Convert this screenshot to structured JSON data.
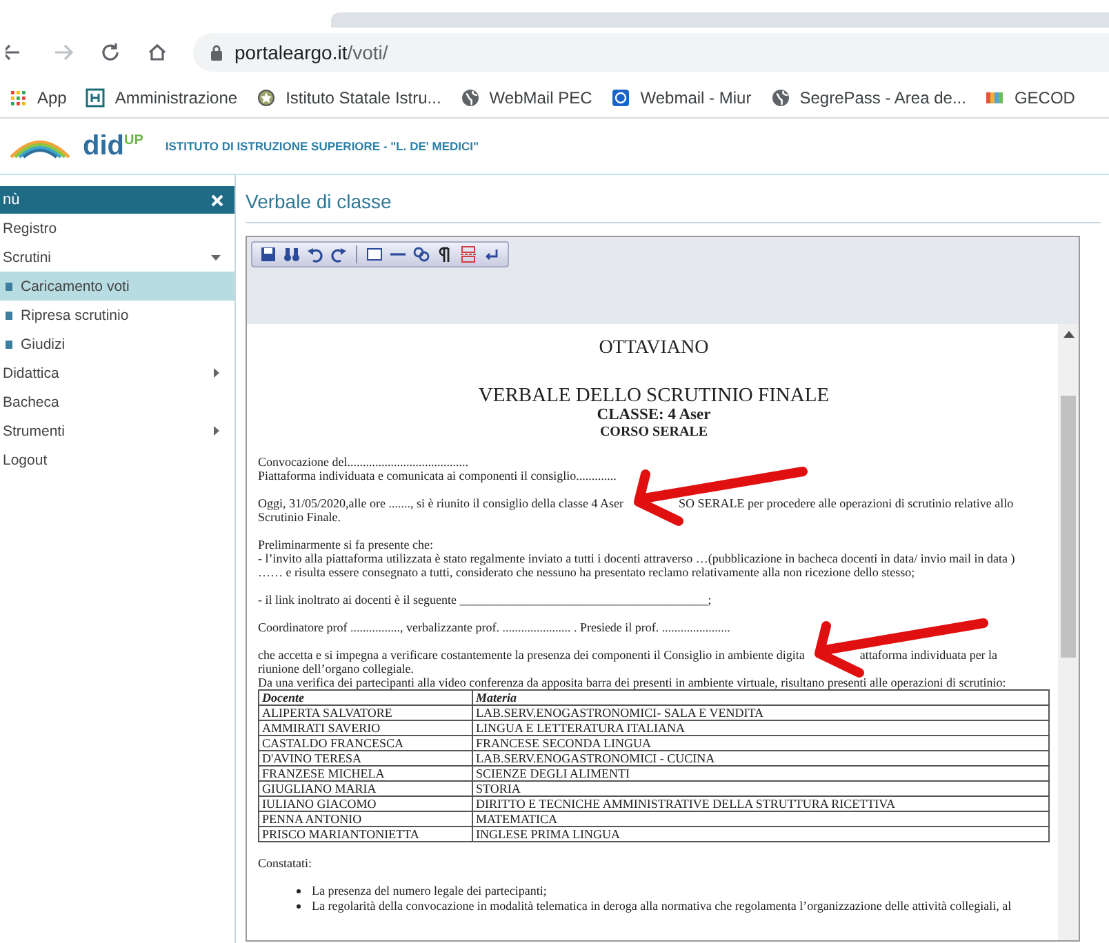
{
  "browser": {
    "url_host": "portaleargo.it",
    "url_path": "/voti/",
    "bookmarks": [
      {
        "label": "App",
        "kind": "apps"
      },
      {
        "label": "Amministrazione",
        "kind": "letter"
      },
      {
        "label": "Istituto Statale Istru...",
        "kind": "emblem"
      },
      {
        "label": "WebMail PEC",
        "kind": "globe"
      },
      {
        "label": "Webmail - Miur",
        "kind": "blue"
      },
      {
        "label": "SegrePass - Area de...",
        "kind": "globe"
      },
      {
        "label": "GECOD",
        "kind": "colors"
      }
    ]
  },
  "header": {
    "logo": "did",
    "logo_sup": "UP",
    "school": "ISTITUTO DI ISTRUZIONE SUPERIORE - \"L. DE' MEDICI\""
  },
  "sidebar": {
    "title": "nù",
    "items": [
      {
        "label": "Registro",
        "kind": "link",
        "selected": false
      },
      {
        "label": "Scrutini",
        "kind": "group",
        "expanded": true,
        "selected": false
      },
      {
        "label": "Caricamento voti",
        "kind": "sub",
        "selected": true
      },
      {
        "label": "Ripresa scrutinio",
        "kind": "sub",
        "selected": false
      },
      {
        "label": "Giudizi",
        "kind": "sub",
        "selected": false
      },
      {
        "label": "Didattica",
        "kind": "group",
        "expanded": false,
        "selected": false
      },
      {
        "label": "Bacheca",
        "kind": "link",
        "selected": false
      },
      {
        "label": "Strumenti",
        "kind": "group",
        "expanded": false,
        "selected": false
      },
      {
        "label": "Logout",
        "kind": "link",
        "selected": false
      }
    ]
  },
  "page_title": "Verbale di classe",
  "document": {
    "blocks": [
      {
        "kind": "title",
        "text": "OTTAVIANO"
      },
      {
        "kind": "main_title",
        "text": "VERBALE DELLO SCRUTINIO FINALE"
      },
      {
        "kind": "subtitle",
        "text": "CLASSE: 4 Aser"
      },
      {
        "kind": "small_title",
        "text": "CORSO SERALE"
      },
      {
        "kind": "para",
        "lines": [
          [
            "Convocazione del......................................."
          ],
          [
            "Piattaforma individuata e comunicata ai componenti il consiglio............."
          ]
        ]
      },
      {
        "kind": "para",
        "lines": [
          [
            "Oggi, 31/05/2020,alle ore ......., si è riunito il consiglio della classe  4 Aser",
            "SO SERALE per procedere alle operazioni di scrutinio relative allo"
          ],
          [
            "Scrutinio Finale."
          ]
        ]
      },
      {
        "kind": "para",
        "lines": [
          [
            "Preliminarmente si fa presente che:"
          ],
          [
            "- l’invito alla piattaforma utilizzata è stato regalmente inviato a tutti i docenti attraverso …(pubblicazione in bacheca docenti in data/ invio mail in data )"
          ],
          [
            "…… e risulta essere consegnato a tutti, considerato che nessuno ha presentato reclamo relativamente alla non ricezione dello stesso;"
          ]
        ]
      },
      {
        "kind": "para",
        "lines": [
          [
            "- il link inoltrato ai docenti è il seguente ________________________________________;"
          ]
        ]
      },
      {
        "kind": "para",
        "lines": [
          [
            "Coordinatore prof ................, verbalizzante prof. ...................... . Presiede il prof. ......................"
          ]
        ]
      },
      {
        "kind": "para",
        "lines": [
          [
            "che accetta e si impegna a verificare costantemente la presenza dei componenti il Consiglio in ambiente digita",
            "attaforma individuata per la"
          ],
          [
            "riunione dell’organo collegiale."
          ],
          [
            "Da una verifica dei partecipanti alla video conferenza da apposita barra dei presenti in ambiente virtuale, risultano presenti alle operazioni di scrutinio:"
          ]
        ]
      },
      {
        "kind": "table",
        "columns": [
          "Docente",
          "Materia"
        ],
        "rows": [
          [
            "ALIPERTA SALVATORE",
            "LAB.SERV.ENOGASTRONOMICI- SALA E VENDITA"
          ],
          [
            "AMMIRATI SAVERIO",
            "LINGUA E LETTERATURA ITALIANA"
          ],
          [
            "CASTALDO FRANCESCA",
            "FRANCESE SECONDA LINGUA"
          ],
          [
            "D'AVINO TERESA",
            "LAB.SERV.ENOGASTRONOMICI - CUCINA"
          ],
          [
            "FRANZESE MICHELA",
            "SCIENZE DEGLI ALIMENTI"
          ],
          [
            "GIUGLIANO MARIA",
            "STORIA"
          ],
          [
            "IULIANO GIACOMO",
            "DIRITTO E TECNICHE AMMINISTRATIVE DELLA STRUTTURA RICETTIVA"
          ],
          [
            "PENNA ANTONIO",
            "MATEMATICA"
          ],
          [
            "PRISCO MARIANTONIETTA",
            "INGLESE PRIMA LINGUA"
          ]
        ]
      },
      {
        "kind": "para",
        "lines": [
          [
            "Constatati:"
          ]
        ]
      },
      {
        "kind": "bullets",
        "items": [
          "La presenza del numero legale dei partecipanti;",
          "La regolarità della convocazione in modalità telematica in deroga alla normativa che regolamenta l’organizzazione delle attività collegiali, al"
        ]
      }
    ]
  }
}
